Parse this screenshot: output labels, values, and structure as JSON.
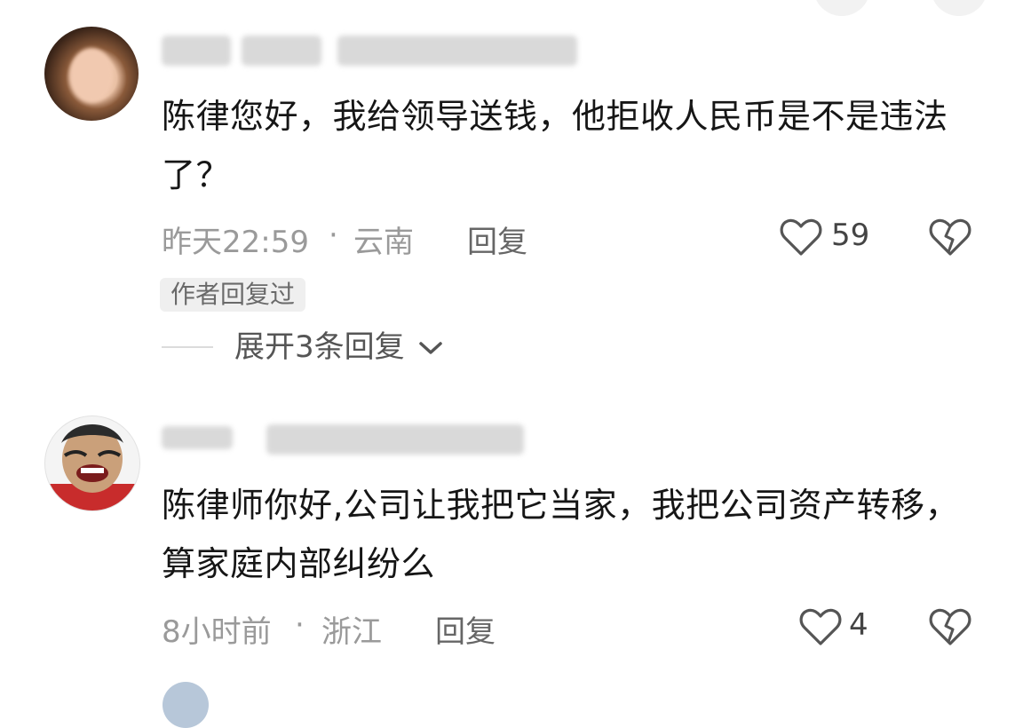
{
  "comments": [
    {
      "text": "陈律您好，我给领导送钱，他拒收人民币是不是违法了？",
      "time": "昨天22:59",
      "separator": "·",
      "location": "云南",
      "reply_label": "回复",
      "likes": "59",
      "author_badge": "作者回复过",
      "expand_label": "展开3条回复"
    },
    {
      "text": "陈律师你好,公司让我把它当家，我把公司资产转移，算家庭内部纠纷么",
      "time": "8小时前",
      "separator": "·",
      "location": "浙江",
      "reply_label": "回复",
      "likes": "4"
    }
  ],
  "icons": {
    "like": "heart-outline-icon",
    "dislike": "broken-heart-icon",
    "expand": "chevron-down-icon"
  },
  "colors": {
    "text": "#161616",
    "meta": "#9a9a9a",
    "badge_bg": "#efefef"
  }
}
